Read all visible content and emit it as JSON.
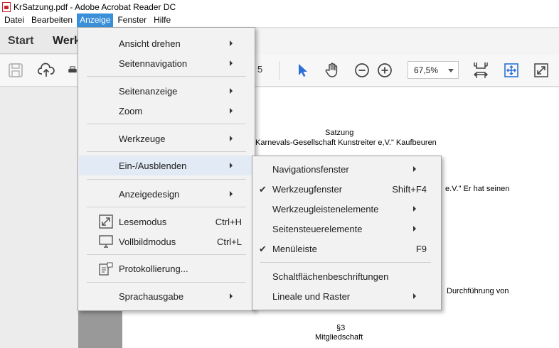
{
  "window": {
    "title": "KrSatzung.pdf - Adobe Acrobat Reader DC"
  },
  "menubar": [
    "Datei",
    "Bearbeiten",
    "Anzeige",
    "Fenster",
    "Hilfe"
  ],
  "tabs": {
    "start": "Start",
    "werkzeuge": "Werk"
  },
  "toolbar": {
    "page_total": "5",
    "zoom": "67,5%"
  },
  "main_menu": {
    "rotate": "Ansicht drehen",
    "page_nav": "Seitennavigation",
    "page_display": "Seitenanzeige",
    "zoom": "Zoom",
    "tools": "Werkzeuge",
    "show_hide": "Ein-/Ausblenden",
    "display_theme": "Anzeigedesign",
    "read_mode": "Lesemodus",
    "read_mode_key": "Ctrl+H",
    "full_screen": "Vollbildmodus",
    "full_screen_key": "Ctrl+L",
    "tracker": "Protokollierung...",
    "read_out_loud": "Sprachausgabe"
  },
  "submenu": {
    "nav_panes": "Navigationsfenster",
    "tools_pane": "Werkzeugfenster",
    "tools_pane_key": "Shift+F4",
    "toolbar_items": "Werkzeugleistenelemente",
    "page_controls": "Seitensteuerelemente",
    "menu_bar": "Menüleiste",
    "menu_bar_key": "F9",
    "button_labels": "Schaltflächenbeschriftungen",
    "rulers_grids": "Lineale und Raster"
  },
  "document": {
    "heading": "Satzung",
    "subtitle": "Karnevals-Gesellschaft Kunstreiter e,V.\" Kaufbeuren",
    "line1": "e.V.\" Er hat seinen",
    "line2": "Durchführung   von",
    "section": "§3",
    "section_title": "Mitgliedschaft"
  },
  "colors": {
    "menu_highlight": "#3a8fd9",
    "icon_blue": "#2d6fd6"
  }
}
